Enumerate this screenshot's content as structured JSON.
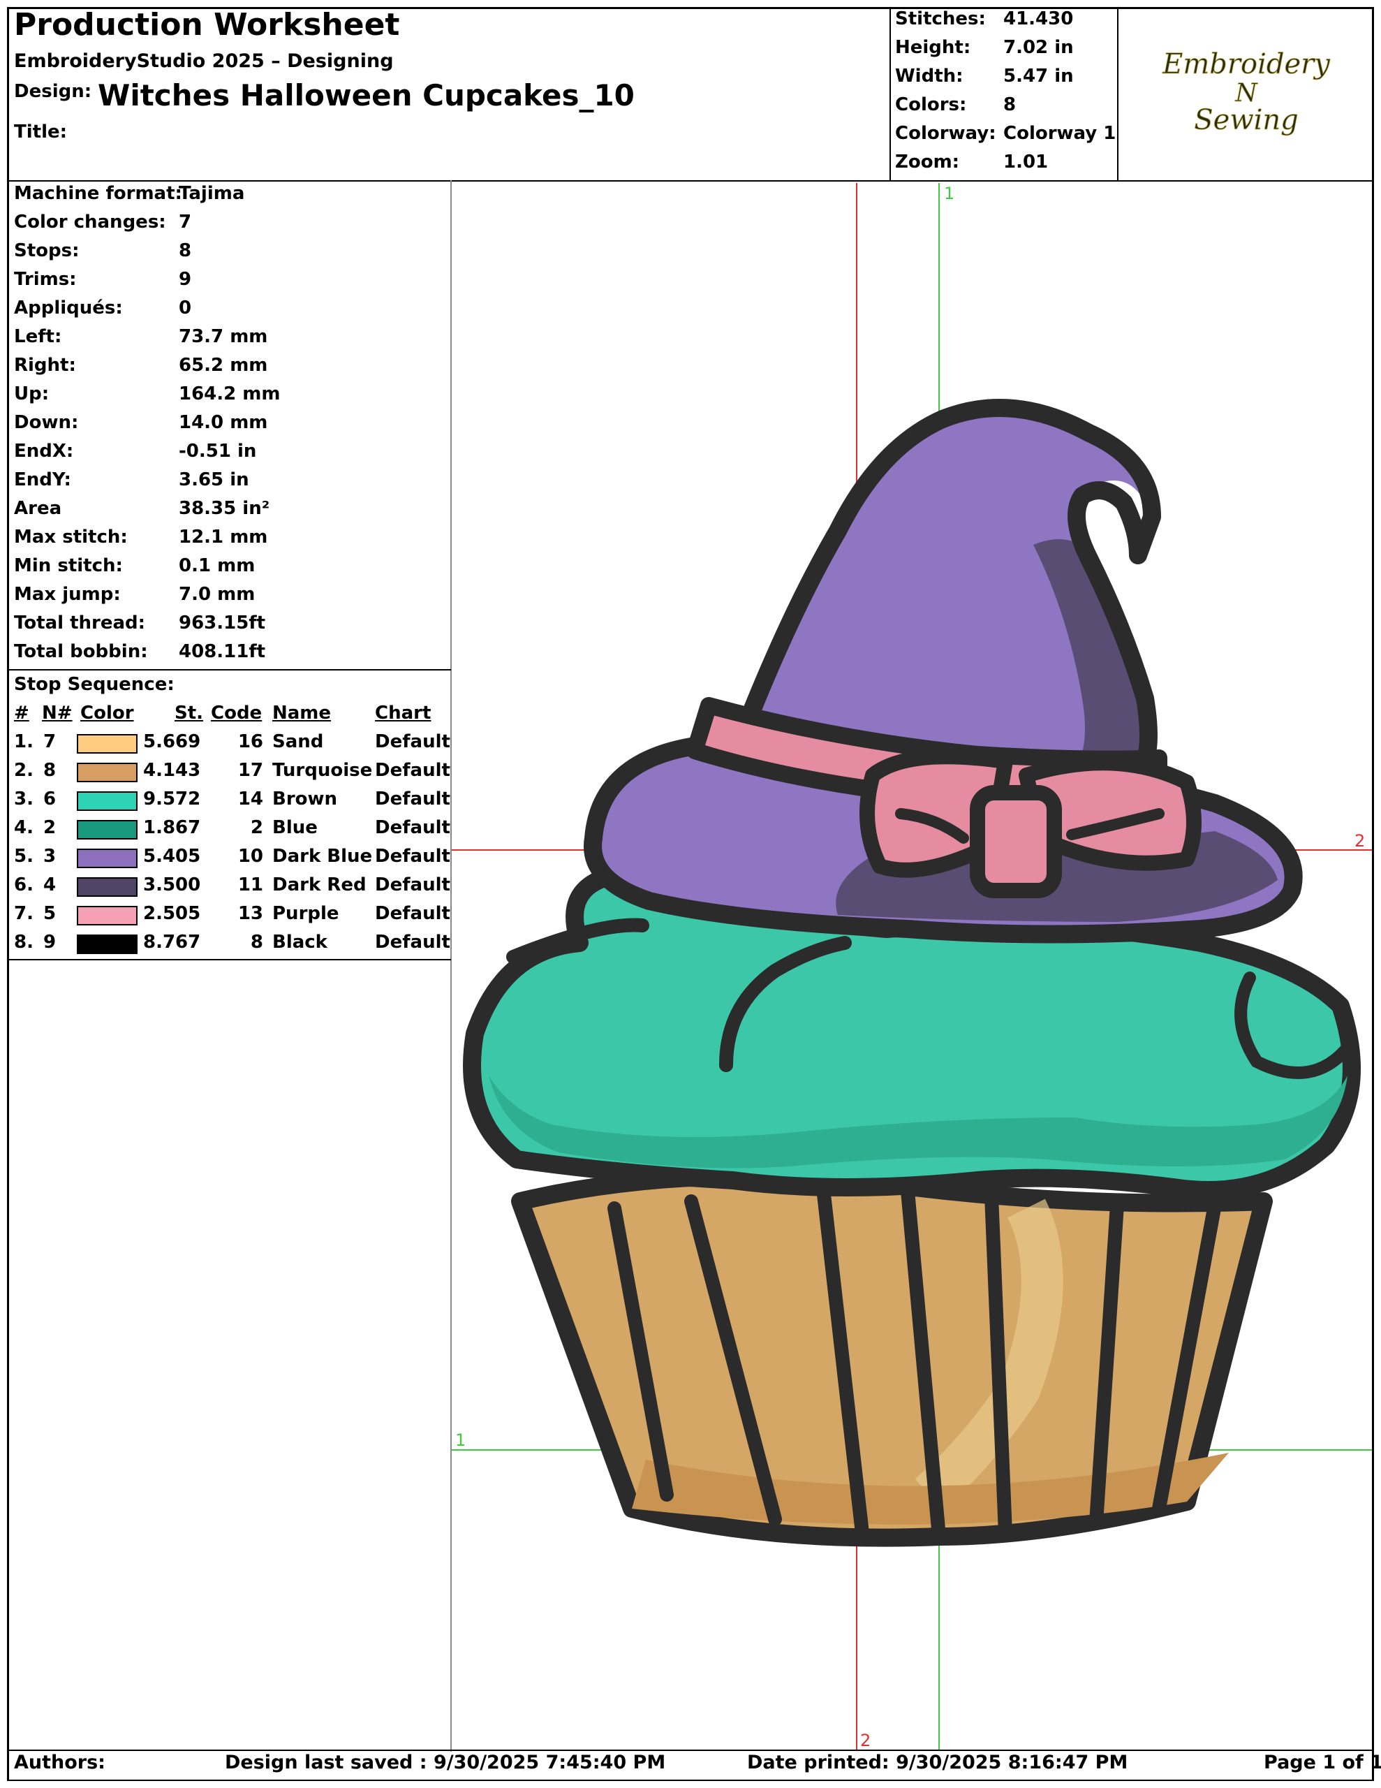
{
  "header": {
    "title": "Production Worksheet",
    "subtitle": "EmbroideryStudio 2025 – Designing",
    "design_label": "Design:",
    "design_name": "Witches Halloween Cupcakes_10",
    "title_label": "Title:"
  },
  "stats": {
    "stitches_label": "Stitches:",
    "stitches": "41.430",
    "height_label": "Height:",
    "height": "7.02 in",
    "width_label": "Width:",
    "width": "5.47 in",
    "colors_label": "Colors:",
    "colors": "8",
    "colorway_label": "Colorway:",
    "colorway": "Colorway 1",
    "zoom_label": "Zoom:",
    "zoom": "1.01"
  },
  "logo": {
    "line1": "Embroidery",
    "line2": "N",
    "line3": "Sewing"
  },
  "specs": [
    {
      "label": "Machine format:",
      "value": "Tajima"
    },
    {
      "label": "Color changes:",
      "value": "7"
    },
    {
      "label": "Stops:",
      "value": "8"
    },
    {
      "label": "Trims:",
      "value": "9"
    },
    {
      "label": "Appliqués:",
      "value": "0"
    },
    {
      "label": "Left:",
      "value": "73.7 mm"
    },
    {
      "label": "Right:",
      "value": "65.2 mm"
    },
    {
      "label": "Up:",
      "value": "164.2 mm"
    },
    {
      "label": "Down:",
      "value": "14.0 mm"
    },
    {
      "label": "EndX:",
      "value": "-0.51 in"
    },
    {
      "label": "EndY:",
      "value": "3.65 in"
    },
    {
      "label": "Area",
      "value": " 38.35 in²"
    },
    {
      "label": "Max stitch:",
      "value": "12.1 mm"
    },
    {
      "label": "Min stitch:",
      "value": "0.1 mm"
    },
    {
      "label": "Max jump:",
      "value": "7.0 mm"
    },
    {
      "label": "Total thread:",
      "value": "963.15ft"
    },
    {
      "label": "Total bobbin:",
      "value": "408.11ft"
    }
  ],
  "stop_sequence": {
    "title": "Stop Sequence:",
    "headers": {
      "num": "#",
      "n": "N#",
      "color": "Color",
      "st": "St.",
      "code": "Code",
      "name": "Name",
      "chart": "Chart"
    },
    "rows": [
      {
        "num": "1.",
        "n": "7",
        "color": "#FFCC80",
        "st": "5.669",
        "code": "16",
        "name": "Sand",
        "chart": "Default"
      },
      {
        "num": "2.",
        "n": "8",
        "color": "#D69E62",
        "st": "4.143",
        "code": "17",
        "name": "Turquoise",
        "chart": "Default"
      },
      {
        "num": "3.",
        "n": "6",
        "color": "#2ED3B5",
        "st": "9.572",
        "code": "14",
        "name": "Brown",
        "chart": "Default"
      },
      {
        "num": "4.",
        "n": "2",
        "color": "#18987C",
        "st": "1.867",
        "code": "2",
        "name": "Blue",
        "chart": "Default"
      },
      {
        "num": "5.",
        "n": "3",
        "color": "#8E6FBE",
        "st": "5.405",
        "code": "10",
        "name": "Dark Blue",
        "chart": "Default"
      },
      {
        "num": "6.",
        "n": "4",
        "color": "#4F4466",
        "st": "3.500",
        "code": "11",
        "name": "Dark Red",
        "chart": "Default"
      },
      {
        "num": "7.",
        "n": "5",
        "color": "#F5A0B5",
        "st": "2.505",
        "code": "13",
        "name": "Purple",
        "chart": "Default"
      },
      {
        "num": "8.",
        "n": "9",
        "color": "#000000",
        "st": "8.767",
        "code": "8",
        "name": "Black",
        "chart": "Default"
      }
    ]
  },
  "guides": {
    "v1": "1",
    "h2": "2",
    "h1": "1",
    "v2": "2"
  },
  "footer": {
    "authors": "Authors:",
    "saved": "Design last saved : 9/30/2025 7:45:40 PM",
    "printed": "Date printed: 9/30/2025 8:16:47 PM",
    "page": "Page 1 of 1"
  }
}
